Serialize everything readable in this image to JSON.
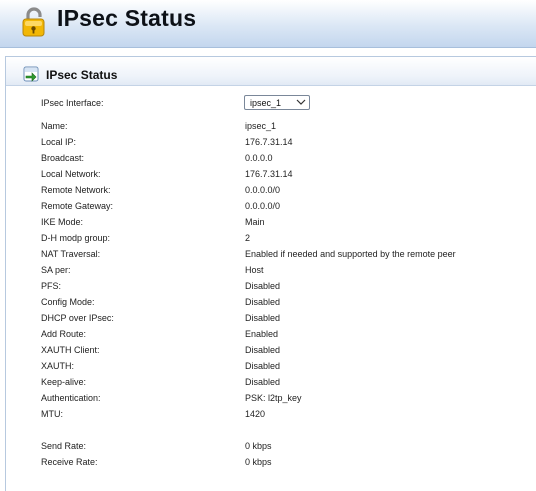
{
  "header": {
    "title": "IPsec Status",
    "icon": "lock-icon"
  },
  "panel": {
    "title": "IPsec Status",
    "icon": "status-arrow-icon"
  },
  "interface": {
    "label": "IPsec Interface:",
    "selected": "ipsec_1"
  },
  "fields": [
    {
      "label": "Name:",
      "value": "ipsec_1"
    },
    {
      "label": "Local IP:",
      "value": "176.7.31.14"
    },
    {
      "label": "Broadcast:",
      "value": "0.0.0.0"
    },
    {
      "label": "Local Network:",
      "value": "176.7.31.14"
    },
    {
      "label": "Remote Network:",
      "value": "0.0.0.0/0"
    },
    {
      "label": "Remote Gateway:",
      "value": "0.0.0.0/0"
    },
    {
      "label": "IKE Mode:",
      "value": "Main"
    },
    {
      "label": "D-H modp group:",
      "value": "2"
    },
    {
      "label": "NAT Traversal:",
      "value": "Enabled if needed and supported by the remote peer"
    },
    {
      "label": "SA per:",
      "value": "Host"
    },
    {
      "label": "PFS:",
      "value": "Disabled"
    },
    {
      "label": "Config Mode:",
      "value": "Disabled"
    },
    {
      "label": "DHCP over IPsec:",
      "value": "Disabled"
    },
    {
      "label": "Add Route:",
      "value": "Enabled"
    },
    {
      "label": "XAUTH Client:",
      "value": "Disabled"
    },
    {
      "label": "XAUTH:",
      "value": "Disabled"
    },
    {
      "label": "Keep-alive:",
      "value": "Disabled"
    },
    {
      "label": "Authentication:",
      "value": "PSK: l2tp_key"
    },
    {
      "label": "MTU:",
      "value": "1420"
    }
  ],
  "rates": [
    {
      "label": "Send Rate:",
      "value": "0 kbps"
    },
    {
      "label": "Receive Rate:",
      "value": "0 kbps"
    }
  ]
}
